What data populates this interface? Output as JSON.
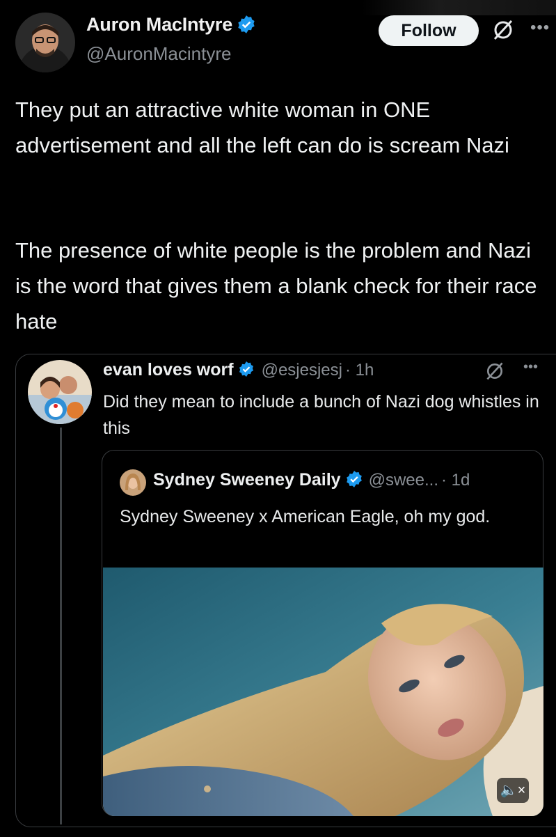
{
  "post": {
    "author_name": "Auron MacIntyre",
    "author_handle": "@AuronMacintyre",
    "follow_label": "Follow",
    "paragraphs": [
      "They put an attractive white woman in ONE advertisement and all the left can do is scream Nazi",
      "The presence of white people is the problem and Nazi is the word that gives them a blank check for their race hate"
    ]
  },
  "quoted": {
    "author_name": "evan loves worf",
    "author_handle": "@esjesjesj",
    "timestamp": "· 1h",
    "text": "Did they mean to include a bunch of Nazi dog whistles in this"
  },
  "nested_quoted": {
    "author_name": "Sydney Sweeney Daily",
    "author_handle": "@swee...",
    "timestamp": "· 1d",
    "text": "Sydney Sweeney x American Eagle, oh my god."
  },
  "icons": {
    "verified": "verified-badge-icon",
    "grok": "grok-icon",
    "more": "more-icon",
    "mute": "volume-muted-icon"
  },
  "colors": {
    "background": "#000000",
    "verified_blue": "#1d9bf0",
    "follow_bg": "#eff3f4",
    "secondary_text": "#8b9096"
  }
}
